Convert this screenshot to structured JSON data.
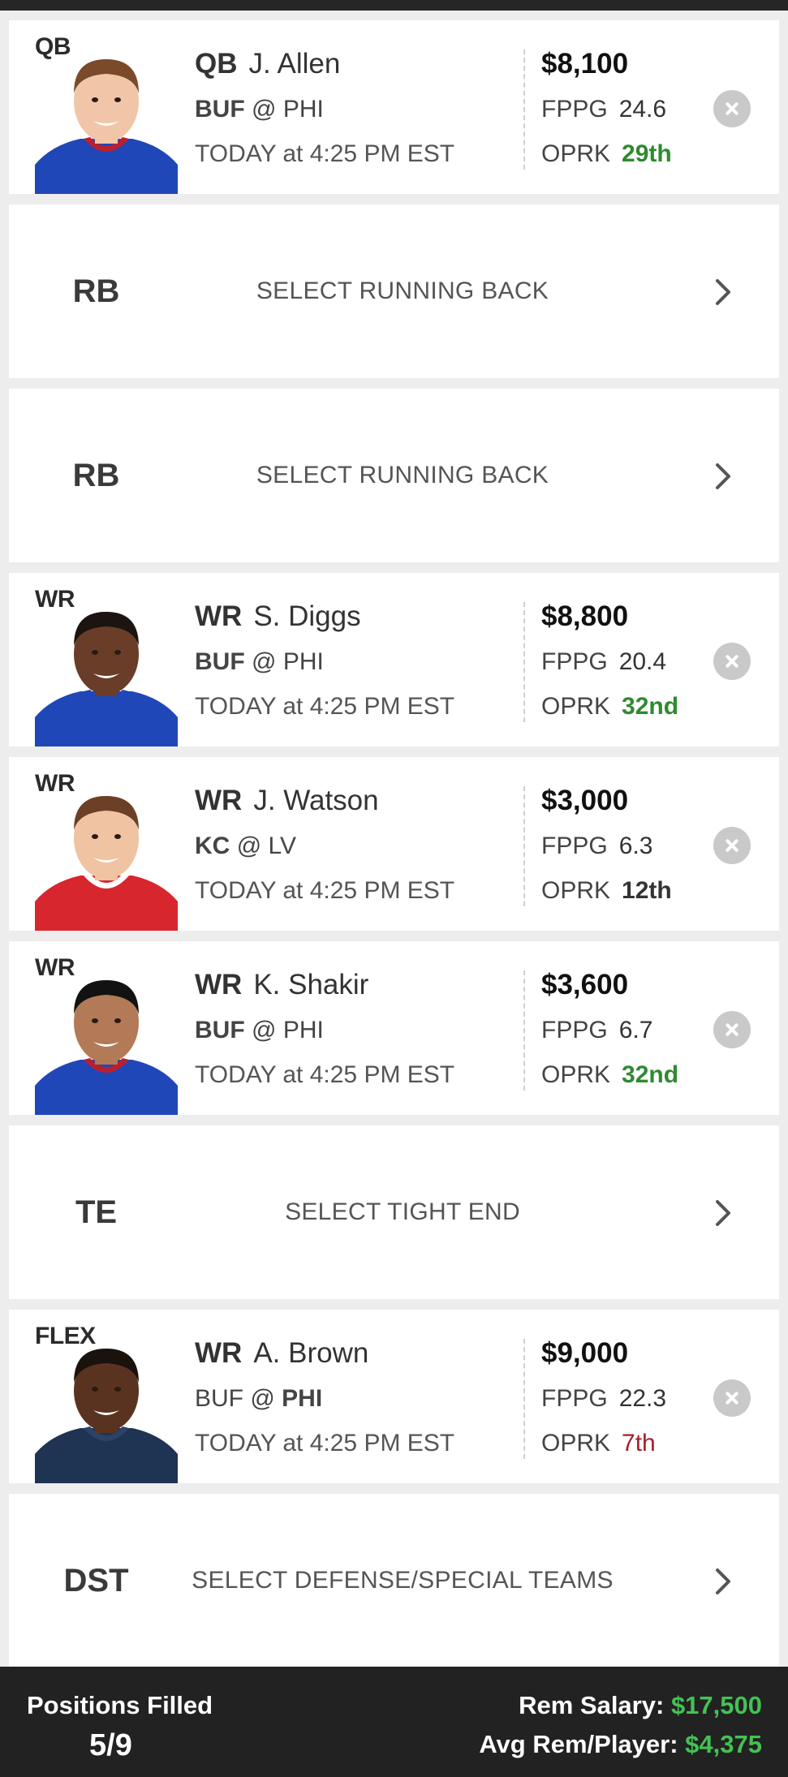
{
  "lineup": {
    "slots": [
      {
        "slot": "QB",
        "filled": true,
        "pos": "QB",
        "name": "J. Allen",
        "team": "BUF",
        "separator": "@",
        "opponent": "PHI",
        "bold_side": "team",
        "time": "TODAY at 4:25 PM EST",
        "salary": "$8,100",
        "fppg_label": "FPPG",
        "fppg": "24.6",
        "oprk_label": "OPRK",
        "oprk": "29th",
        "oprk_tone": "good",
        "jersey_color": "#1f47b8",
        "collar_color": "#b8202f",
        "skin_color": "#f1c6a8",
        "hair_color": "#7a4a2b"
      },
      {
        "slot": "RB",
        "filled": false,
        "label": "SELECT RUNNING BACK"
      },
      {
        "slot": "RB",
        "filled": false,
        "label": "SELECT RUNNING BACK"
      },
      {
        "slot": "WR",
        "filled": true,
        "pos": "WR",
        "name": "S. Diggs",
        "team": "BUF",
        "separator": "@",
        "opponent": "PHI",
        "bold_side": "team",
        "time": "TODAY at 4:25 PM EST",
        "salary": "$8,800",
        "fppg_label": "FPPG",
        "fppg": "20.4",
        "oprk_label": "OPRK",
        "oprk": "32nd",
        "oprk_tone": "good",
        "jersey_color": "#1f47b8",
        "collar_color": "#1f47b8",
        "skin_color": "#6a3d28",
        "hair_color": "#1b1410"
      },
      {
        "slot": "WR",
        "filled": true,
        "pos": "WR",
        "name": "J. Watson",
        "team": "KC",
        "separator": "@",
        "opponent": "LV",
        "bold_side": "team",
        "time": "TODAY at 4:25 PM EST",
        "salary": "$3,000",
        "fppg_label": "FPPG",
        "fppg": "6.3",
        "oprk_label": "OPRK",
        "oprk": "12th",
        "oprk_tone": "neutral",
        "jersey_color": "#d8262e",
        "collar_color": "#ffffff",
        "skin_color": "#f0c3a2",
        "hair_color": "#6b4026"
      },
      {
        "slot": "WR",
        "filled": true,
        "pos": "WR",
        "name": "K. Shakir",
        "team": "BUF",
        "separator": "@",
        "opponent": "PHI",
        "bold_side": "team",
        "time": "TODAY at 4:25 PM EST",
        "salary": "$3,600",
        "fppg_label": "FPPG",
        "fppg": "6.7",
        "oprk_label": "OPRK",
        "oprk": "32nd",
        "oprk_tone": "good",
        "jersey_color": "#1f47b8",
        "collar_color": "#b8202f",
        "skin_color": "#b27a56",
        "hair_color": "#121212"
      },
      {
        "slot": "TE",
        "filled": false,
        "label": "SELECT TIGHT END"
      },
      {
        "slot": "FLEX",
        "filled": true,
        "pos": "WR",
        "name": "A. Brown",
        "team": "BUF",
        "separator": "@",
        "opponent": "PHI",
        "bold_side": "opponent",
        "time": "TODAY at 4:25 PM EST",
        "salary": "$9,000",
        "fppg_label": "FPPG",
        "fppg": "22.3",
        "oprk_label": "OPRK",
        "oprk": "7th",
        "oprk_tone": "bad",
        "jersey_color": "#1f3352",
        "collar_color": "#2a4366",
        "skin_color": "#5a3320",
        "hair_color": "#1a120d"
      },
      {
        "slot": "DST",
        "filled": false,
        "label": "SELECT DEFENSE/SPECIAL TEAMS"
      }
    ]
  },
  "footer": {
    "positions_label": "Positions Filled",
    "positions_value": "5/9",
    "rem_salary_label": "Rem Salary:",
    "rem_salary_value": "$17,500",
    "avg_label": "Avg Rem/Player:",
    "avg_value": "$4,375"
  },
  "colors": {
    "good": "#2f8a2f",
    "bad": "#a51e2a",
    "money": "#43c253",
    "footer_bg": "#222222"
  },
  "icons": {
    "remove": "close-circle-icon",
    "select": "chevron-right-icon"
  }
}
